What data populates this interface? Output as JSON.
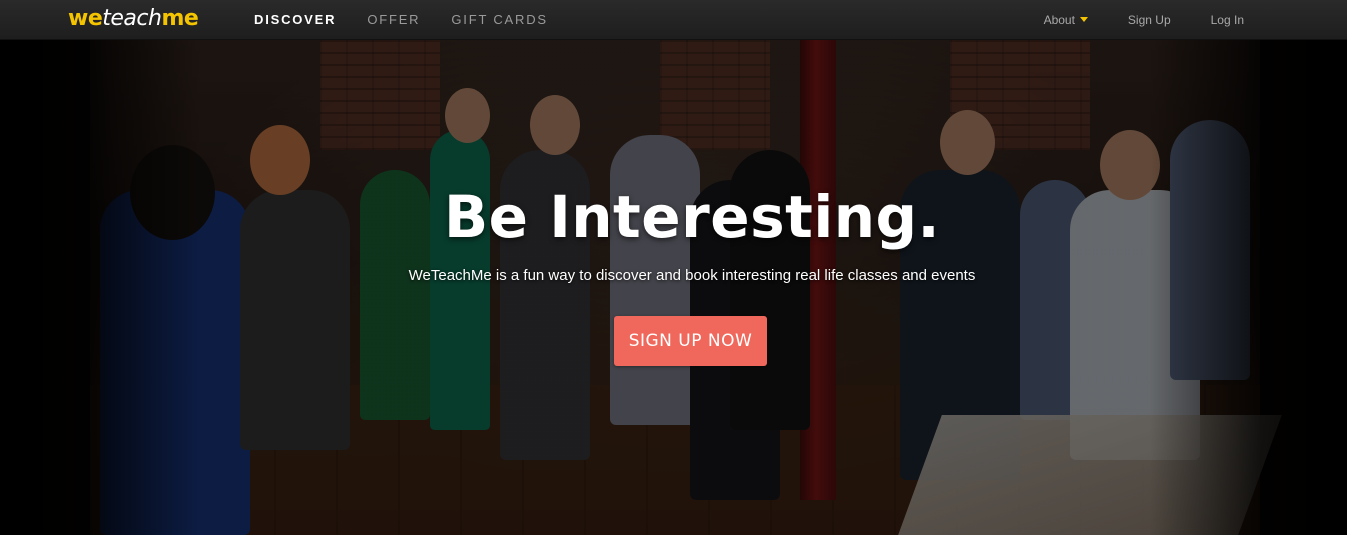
{
  "brand": {
    "logo_we": "we",
    "logo_teach": "teach",
    "logo_me": "me"
  },
  "nav": {
    "items": [
      {
        "label": "DISCOVER",
        "active": true
      },
      {
        "label": "OFFER",
        "active": false
      },
      {
        "label": "GIFT CARDS",
        "active": false
      }
    ]
  },
  "account_nav": {
    "about_label": "About",
    "signup_label": "Sign Up",
    "login_label": "Log In"
  },
  "hero": {
    "headline": "Be Interesting.",
    "subheadline": "WeTeachMe is a fun way to discover and book interesting real life classes and events",
    "cta_label": "SIGN UP NOW"
  },
  "colors": {
    "logo_yellow": "#f5c400",
    "cta_coral": "#f0685c",
    "topbar": "#232323",
    "nav_active": "#ffffff",
    "nav_inactive": "#9a9a9a"
  }
}
